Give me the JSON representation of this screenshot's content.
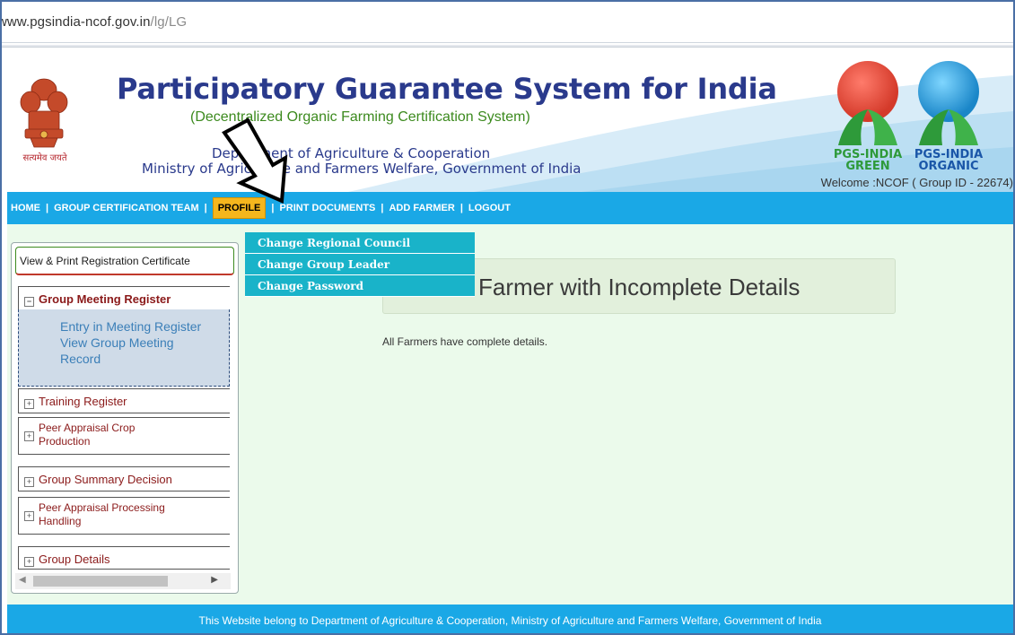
{
  "browser": {
    "url_host": "www.pgsindia-ncof.gov.in",
    "url_path": "/lg/LG"
  },
  "header": {
    "title": "Participatory Guarantee System for India",
    "subtitle": "(Decentralized Organic Farming Certification System)",
    "dept": "Department of Agriculture & Cooperation",
    "ministry": "Ministry of Agriculture and Farmers Welfare, Government of India",
    "emblem_caption": "सत्यमेव जयते",
    "logo_green_line1": "PGS-INDIA",
    "logo_green_line2": "GREEN",
    "logo_organic_line1": "PGS-INDIA",
    "logo_organic_line2": "ORGANIC",
    "welcome": "Welcome :NCOF ( Group ID - 22674)"
  },
  "nav": {
    "items": [
      "HOME",
      "GROUP CERTIFICATION TEAM",
      "PROFILE",
      "PRINT DOCUMENTS",
      "ADD FARMER",
      "LOGOUT"
    ],
    "active": "PROFILE",
    "dropdown": [
      "Change Regional Council",
      "Change Group Leader",
      "Change Password"
    ]
  },
  "sidebar": {
    "top_link": "View & Print Registration Certificate",
    "open_section": "Group Meeting Register",
    "open_links": [
      "Entry in Meeting Register",
      "View Group Meeting Record"
    ],
    "sections": [
      {
        "line1": "Training Register",
        "line2": ""
      },
      {
        "line1": "Peer Appraisal Crop",
        "line2": "Production"
      },
      {
        "line1": "Group Summary Decision",
        "line2": ""
      },
      {
        "line1": "Peer Appraisal Processing",
        "line2": "Handling"
      },
      {
        "line1": "Group Details",
        "line2": ""
      }
    ]
  },
  "main": {
    "panel_title": "Farmer with Incomplete Details",
    "info": "All Farmers have complete details."
  },
  "footer": {
    "text": "This Website belong to Department of Agriculture & Cooperation, Ministry of Agriculture and Farmers Welfare, Government of India"
  },
  "colors": {
    "nav_bg": "#1aa8e6",
    "active_tab": "#f5b61d",
    "dropdown_bg": "#19b3c9",
    "content_bg": "#ebfaeb",
    "title": "#2a3a8c"
  },
  "icons": [
    "ashoka-emblem-icon",
    "pgs-green-logo-icon",
    "pgs-organic-logo-icon",
    "expand-icon",
    "collapse-icon",
    "arrow-pointer-icon"
  ]
}
